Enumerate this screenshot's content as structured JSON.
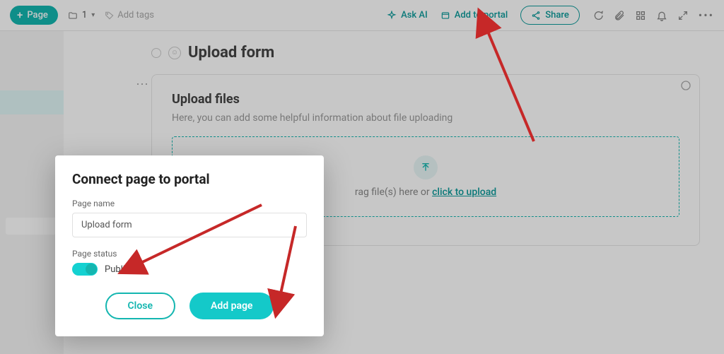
{
  "topbar": {
    "page_button": "Page",
    "breadcrumb_value": "1",
    "add_tags": "Add tags",
    "ask_ai": "Ask AI",
    "add_to_portal": "Add to portal",
    "share": "Share"
  },
  "page": {
    "title": "Upload form"
  },
  "card": {
    "heading": "Upload files",
    "subheading": "Here, you can add some helpful information about file uploading",
    "dropzone_text_prefix": "rag file(s) here or ",
    "dropzone_link": "click to upload"
  },
  "modal": {
    "title": "Connect page to portal",
    "name_label": "Page name",
    "name_value": "Upload form",
    "status_label": "Page status",
    "status_value": "Published",
    "close": "Close",
    "add": "Add page"
  }
}
